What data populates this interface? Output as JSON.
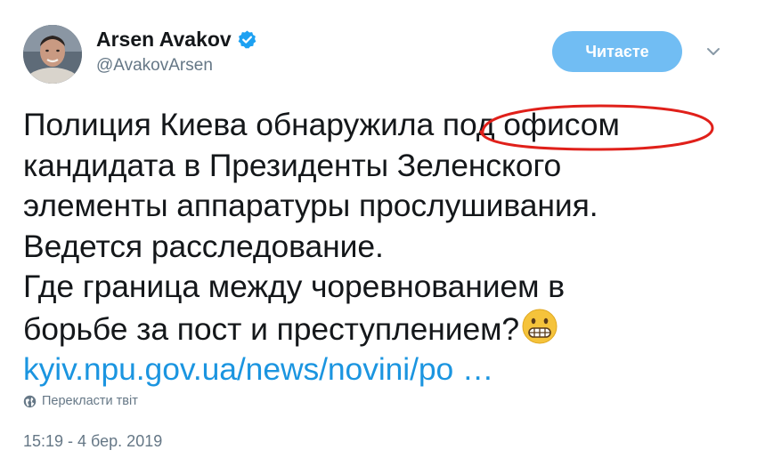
{
  "author": {
    "name": "Arsen Avakov",
    "handle": "@AvakovArsen",
    "verified": true
  },
  "follow_button": {
    "label": "Читаєте"
  },
  "tweet": {
    "lines": [
      "Полиция Киева обнаружила под офисом",
      "кандидата в Президенты Зеленского",
      "элементы аппаратуры прослушивания.",
      "Ведется расследование.",
      "Где граница между чоревнованием в",
      "борьбе за пост и преступлением?"
    ],
    "link": "kyiv.npu.gov.ua/news/novini/po …",
    "emoji": "grimacing-face"
  },
  "translate_label": "Перекласти твіт",
  "timestamp": "15:19 - 4 бер. 2019",
  "colors": {
    "follow_button": "#71bdf3",
    "link": "#1b95e0",
    "secondary_text": "#657786",
    "verified": "#1da1f2",
    "highlight_ellipse": "#e0201a"
  }
}
